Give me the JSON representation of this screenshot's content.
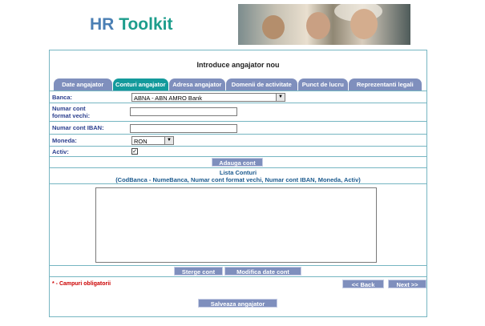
{
  "header": {
    "logo_part1": "HR",
    "logo_part2": "Toolkit"
  },
  "page_title": "Introduce angajator nou",
  "tabs": [
    {
      "label": "Date angajator",
      "active": false
    },
    {
      "label": "Conturi angajator",
      "active": true
    },
    {
      "label": "Adresa angajator",
      "active": false
    },
    {
      "label": "Domenii de activitate",
      "active": false
    },
    {
      "label": "Punct de lucru",
      "active": false
    },
    {
      "label": "Reprezentanti legali",
      "active": false
    }
  ],
  "form": {
    "banca_label": "Banca:",
    "banca_value": "ABNA - ABN AMRO Bank",
    "cont_vechi_label_1": "Numar cont",
    "cont_vechi_label_2": "format vechi:",
    "cont_vechi_value": "",
    "iban_label": "Numar cont IBAN:",
    "iban_value": "",
    "moneda_label": "Moneda:",
    "moneda_value": "RON",
    "activ_label": "Activ:",
    "activ_checked": true,
    "activ_mark": "✓",
    "add_button": "Adauga cont"
  },
  "accounts_list": {
    "title": "Lista Conturi",
    "columns_hint": "(CodBanca - NumeBanca, Numar cont format vechi, Numar cont IBAN, Moneda, Activ)",
    "items": []
  },
  "actions": {
    "delete_button": "Sterge cont",
    "modify_button": "Modifica date cont",
    "required_note": "* - Campuri obligatorii",
    "back_button": "<< Back",
    "next_button": "Next >>",
    "save_button": "Salveaza angajator"
  },
  "colors": {
    "tab": "#7f8fbd",
    "tab_active": "#149a9c",
    "border": "#76b6c2",
    "label": "#2b3f8e",
    "required": "#cc0000"
  }
}
